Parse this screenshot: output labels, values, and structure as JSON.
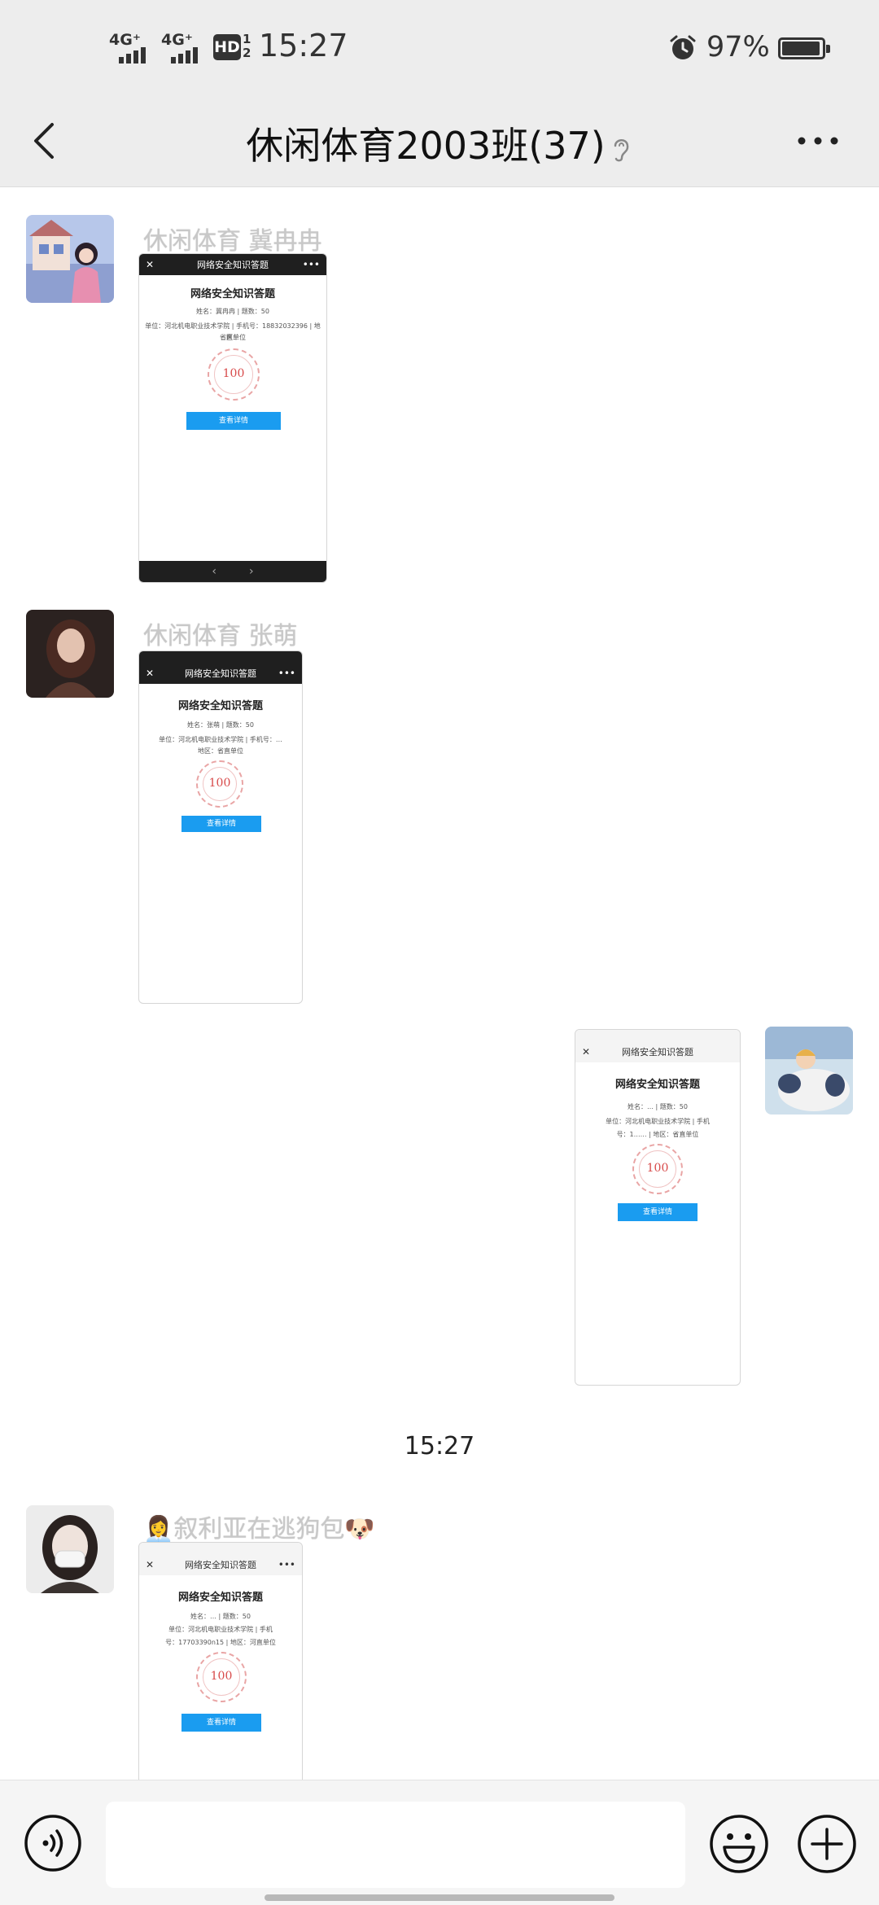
{
  "status_bar": {
    "network1": "4G⁺",
    "network2": "4G⁺",
    "hd_label": "HD",
    "hd_fraction_top": "1",
    "hd_fraction_bottom": "2",
    "time": "15:27",
    "battery_percent": "97%",
    "battery_level": 0.97
  },
  "nav": {
    "title": "休闲体育2003班(37)",
    "back_icon": "chevron-left-icon",
    "more_icon": "more-horizontal-icon"
  },
  "messages": [
    {
      "sender": "休闲体育 冀冉冉",
      "shot": {
        "bar_title": "网络安全知识答题",
        "heading": "网络安全知识答题",
        "line1": "姓名：冀冉冉 | 题数：50",
        "line2": "单位：河北机电职业技术学院 | 手机号：18832032396 | 地区：",
        "line3": "省直单位",
        "score": "100",
        "button": "查看详情",
        "nav_left": "‹",
        "nav_right": "›"
      }
    },
    {
      "sender": "休闲体育 张萌",
      "shot": {
        "bar_title": "网络安全知识答题",
        "heading": "网络安全知识答题",
        "line1": "姓名：张萌 | 题数：50",
        "line2": "单位：河北机电职业技术学院 | 手机号：…",
        "line3": "地区：省直单位",
        "score": "100",
        "button": "查看详情"
      }
    },
    {
      "sender": "",
      "shot": {
        "bar_title": "网络安全知识答题",
        "heading": "网络安全知识答题",
        "line1": "姓名：… | 题数：50",
        "line2": "单位：河北机电职业技术学院 | 手机",
        "line3": "号：1…… | 地区：省直单位",
        "score": "100",
        "button": "查看详情"
      }
    },
    {
      "sender": "👩‍💼叙利亚在逃狗包🐶",
      "shot": {
        "bar_title": "网络安全知识答题",
        "heading": "网络安全知识答题",
        "line1": "姓名：… | 题数：50",
        "line2": "单位：河北机电职业技术学院 | 手机",
        "line3": "号：17703390n15 | 地区：河直单位",
        "score": "100",
        "button": "查看详情"
      }
    }
  ],
  "timestamp": "15:27",
  "input_bar": {
    "voice_icon": "voice-icon",
    "emoji_icon": "emoji-icon",
    "plus_icon": "plus-icon"
  }
}
